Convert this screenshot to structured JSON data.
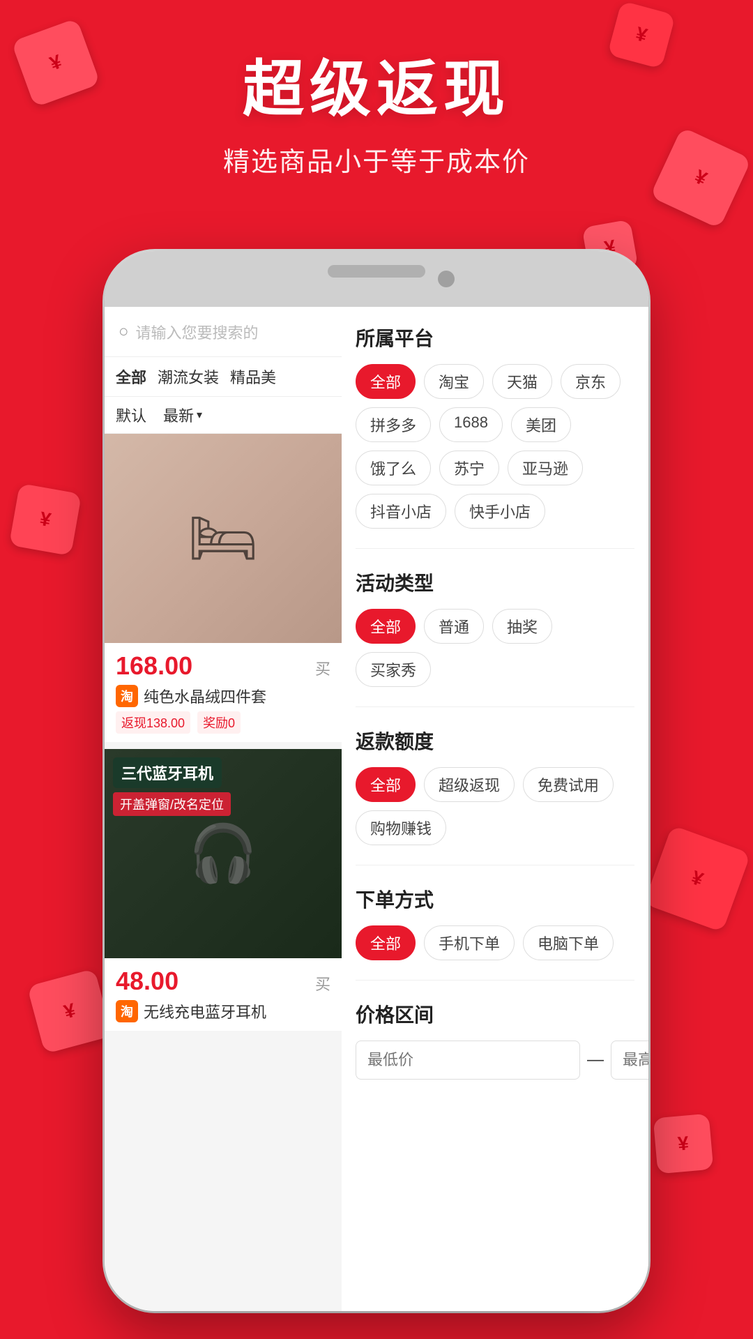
{
  "page": {
    "bg_color": "#e8192c"
  },
  "header": {
    "main_title": "超级返现",
    "subtitle": "精选商品小于等于成本价"
  },
  "phone": {
    "search": {
      "placeholder": "请输入您要搜索的"
    },
    "categories": [
      {
        "label": "全部",
        "active": true
      },
      {
        "label": "潮流女装",
        "active": false
      },
      {
        "label": "精品美",
        "active": false
      }
    ],
    "sort": [
      {
        "label": "默认",
        "arrow": false
      },
      {
        "label": "最新",
        "arrow": true
      }
    ],
    "products": [
      {
        "id": "product-1",
        "image_type": "bed",
        "price": "168.00",
        "buy_label": "买",
        "platform": "淘",
        "platform_type": "taobao",
        "name": "纯色水晶绒四件套",
        "cashback": "返现138.00",
        "reward": "奖励0"
      },
      {
        "id": "product-2",
        "image_type": "earbuds",
        "overlay_title": "三代蓝牙耳机",
        "overlay_sub": "开盖弹窗/改名定位",
        "price": "48.00",
        "buy_label": "买",
        "platform": "淘",
        "platform_type": "taobao",
        "name": "无线充电蓝牙耳机"
      }
    ],
    "filters": {
      "platform_label": "所属平台",
      "platforms": [
        {
          "label": "全部",
          "active": true
        },
        {
          "label": "淘宝",
          "active": false
        },
        {
          "label": "天猫",
          "active": false
        },
        {
          "label": "京东",
          "active": false
        },
        {
          "label": "拼多多",
          "active": false
        },
        {
          "label": "1688",
          "active": false
        },
        {
          "label": "美团",
          "active": false
        },
        {
          "label": "饿了么",
          "active": false
        },
        {
          "label": "苏宁",
          "active": false
        },
        {
          "label": "亚马逊",
          "active": false
        },
        {
          "label": "抖音小店",
          "active": false
        },
        {
          "label": "快手小店",
          "active": false
        }
      ],
      "activity_label": "活动类型",
      "activities": [
        {
          "label": "全部",
          "active": true
        },
        {
          "label": "普通",
          "active": false
        },
        {
          "label": "抽奖",
          "active": false
        },
        {
          "label": "买家秀",
          "active": false
        }
      ],
      "cashback_label": "返款额度",
      "cashbacks": [
        {
          "label": "全部",
          "active": true
        },
        {
          "label": "超级返现",
          "active": false
        },
        {
          "label": "免费试用",
          "active": false
        },
        {
          "label": "购物赚钱",
          "active": false
        }
      ],
      "order_label": "下单方式",
      "orders": [
        {
          "label": "全部",
          "active": true
        },
        {
          "label": "手机下单",
          "active": false
        },
        {
          "label": "电脑下单",
          "active": false
        }
      ],
      "price_label": "价格区间",
      "price_min_placeholder": "最低价",
      "price_max_placeholder": "最高价",
      "price_dash": "—"
    }
  }
}
